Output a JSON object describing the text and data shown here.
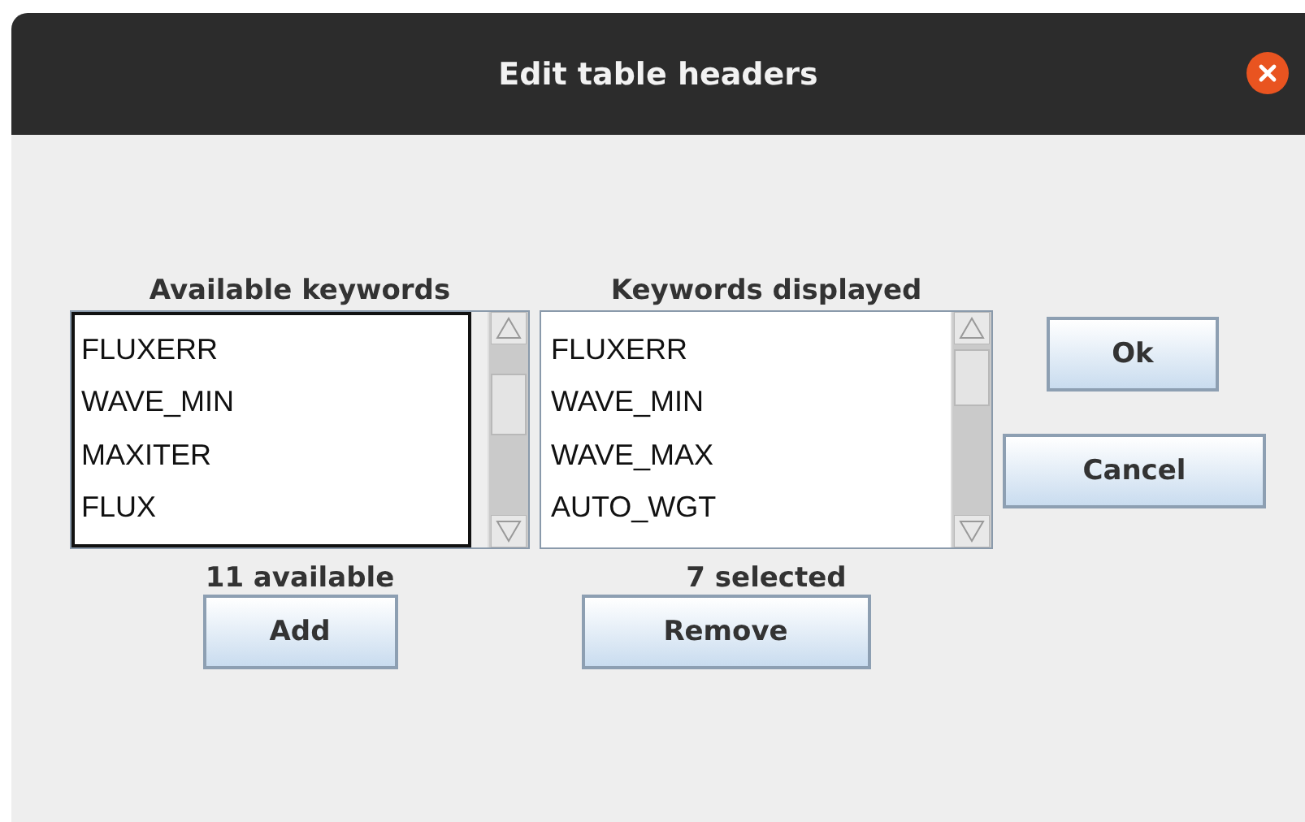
{
  "window": {
    "title": "Edit table headers"
  },
  "lists": [
    {
      "label": "Available keywords",
      "focused": true,
      "items": [
        "FLUXERR",
        "WAVE_MIN",
        "MAXITER",
        "FLUX"
      ],
      "count": "11 available",
      "button": "Add"
    },
    {
      "label": "Keywords displayed",
      "focused": false,
      "items": [
        "FLUXERR",
        "WAVE_MIN",
        "WAVE_MAX",
        "AUTO_WGT"
      ],
      "count": "7 selected",
      "button": "Remove"
    }
  ],
  "buttons": [
    "Ok",
    "Cancel"
  ]
}
